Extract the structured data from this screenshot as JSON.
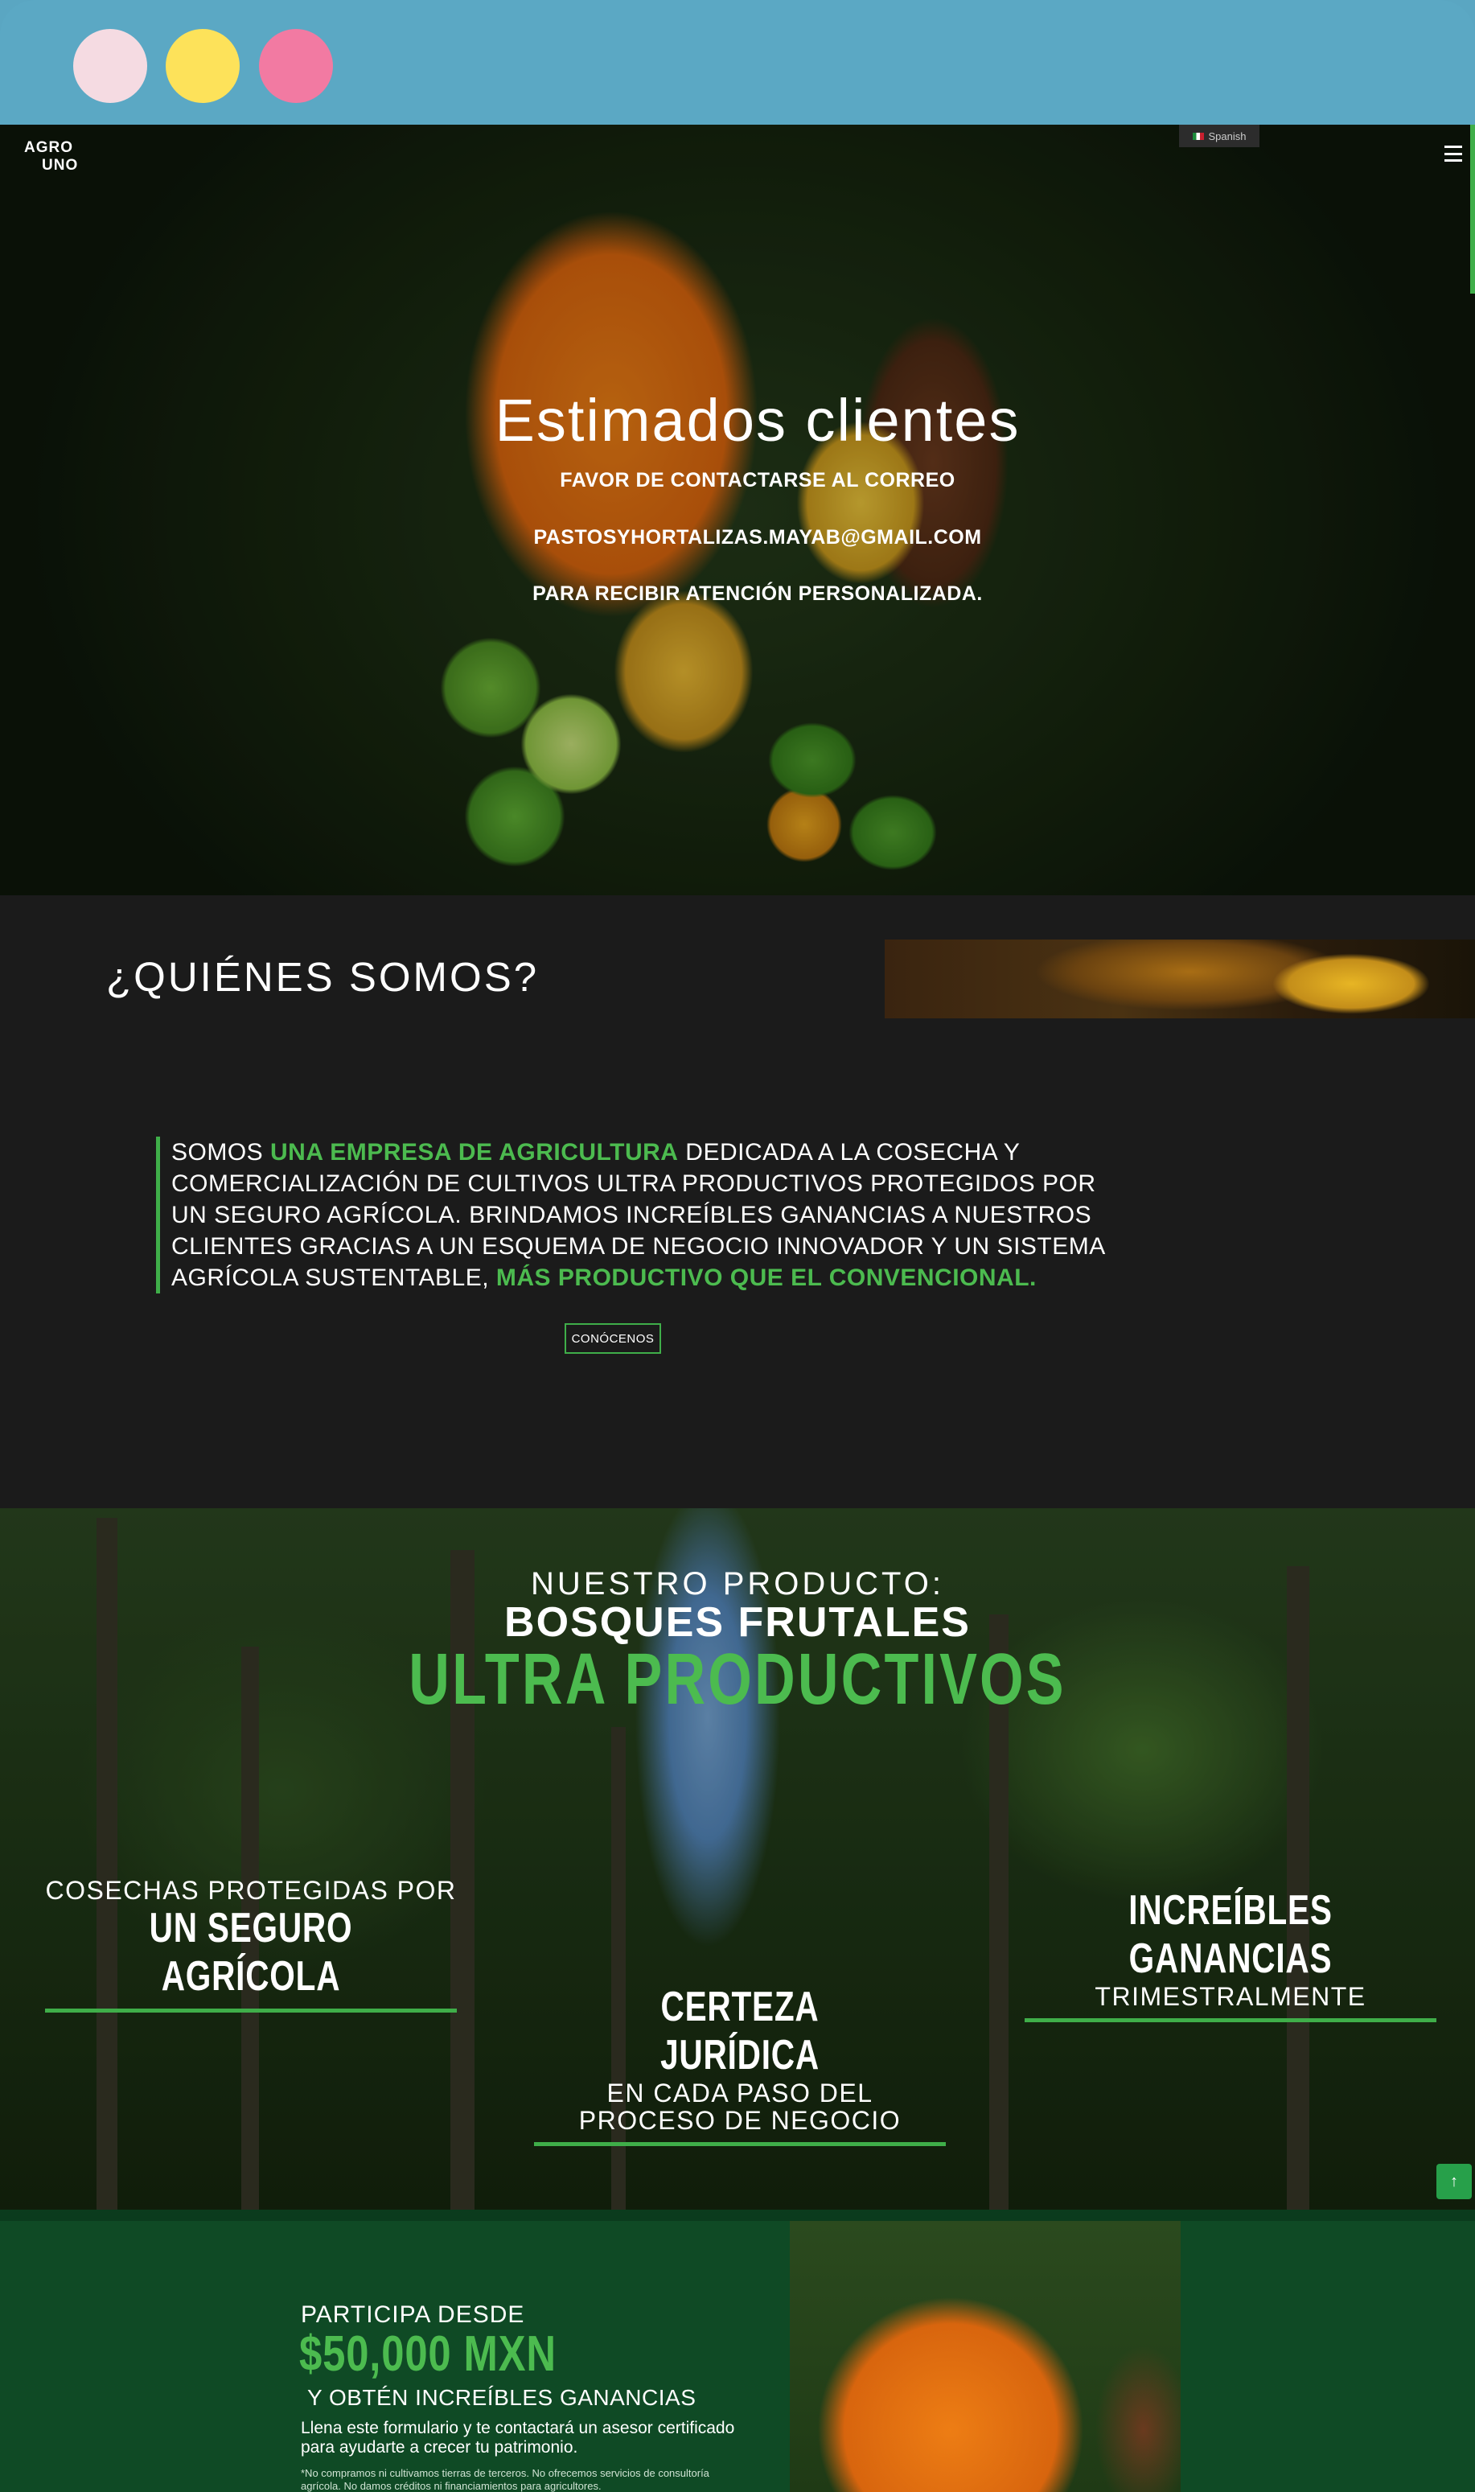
{
  "window": {
    "controls": [
      "close",
      "minimize",
      "maximize"
    ]
  },
  "header": {
    "logo_line1": "AGRO",
    "logo_line2": "UNO",
    "language": "Spanish",
    "menu_icon": "hamburger-icon"
  },
  "hero": {
    "title": "Estimados clientes",
    "line1": "FAVOR DE CONTACTARSE AL CORREO",
    "line2": "PASTOSYHORTALIZAS.MAYAB@GMAIL.COM",
    "line3": "PARA RECIBIR ATENCIÓN PERSONALIZADA."
  },
  "about": {
    "title": "¿QUIÉNES SOMOS?",
    "text_1": "SOMOS ",
    "highlight_1": "UNA EMPRESA DE AGRICULTURA",
    "text_2": " DEDICADA A LA COSECHA Y COMERCIALIZACIÓN DE CULTIVOS ULTRA PRODUCTIVOS PROTEGIDOS POR UN SEGURO AGRÍCOLA. BRINDAMOS INCREÍBLES GANANCIAS A NUESTROS CLIENTES GRACIAS A UN ESQUEMA DE NEGOCIO INNOVADOR Y UN SISTEMA AGRÍCOLA SUSTENTABLE, ",
    "highlight_2": "MÁS PRODUCTIVO QUE EL CONVENCIONAL.",
    "button": "CONÓCENOS"
  },
  "product": {
    "subtitle": "NUESTRO PRODUCTO:",
    "title": "BOSQUES FRUTALES",
    "title_green": "ULTRA PRODUCTIVOS",
    "features": [
      {
        "light": "COSECHAS PROTEGIDAS POR",
        "bold": "UN SEGURO AGRÍCOLA"
      },
      {
        "bold": "CERTEZA JURÍDICA",
        "light": "EN CADA PASO DEL PROCESO DE NEGOCIO"
      },
      {
        "bold": "INCREÍBLES GANANCIAS",
        "light": "TRIMESTRALMENTE"
      }
    ]
  },
  "participa": {
    "line1": "PARTICIPA DESDE",
    "amount": "$50,000 MXN",
    "line2": "Y OBTÉN INCREÍBLES GANANCIAS",
    "description": "Llena este formulario y te contactará un asesor certificado para ayudarte a crecer tu patrimonio.",
    "disclaimer": "*No compramos ni cultivamos tierras de terceros. No ofrecemos servicios de consultoría agrícola. No damos créditos ni financiamientos para agricultores."
  },
  "colors": {
    "accent_green": "#4cbb4f",
    "browser_bar": "#5ba8c4",
    "dark_bg": "#1b1b1b",
    "participa_bg": "#0f4a25"
  }
}
